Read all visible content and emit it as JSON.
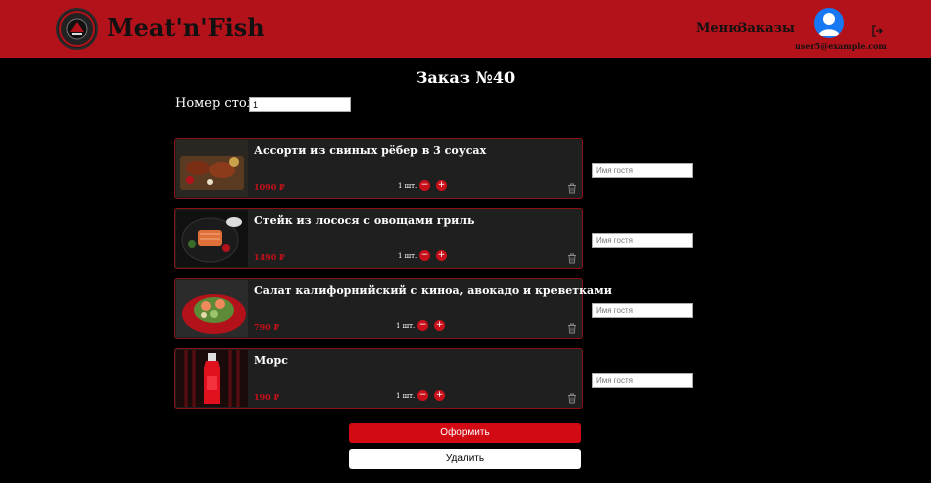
{
  "header": {
    "brand": "Meat'n'Fish",
    "nav": {
      "menu": "Меню",
      "orders": "Заказы"
    },
    "user_email": "user5@example.com"
  },
  "order": {
    "title": "Заказ №40",
    "table_label": "Номер стола:",
    "table_value": "1",
    "items": [
      {
        "name": "Ассорти из свиных рёбер в 3 соусах",
        "price": "1090 ₽",
        "qty": "1 шт.",
        "image": "ribs-platter"
      },
      {
        "name": "Стейк из лосося с овощами гриль",
        "price": "1490 ₽",
        "qty": "1 шт.",
        "image": "salmon-steak"
      },
      {
        "name": "Салат калифорнийский с киноа, авокадо и креветками",
        "price": "790 ₽",
        "qty": "1 шт.",
        "image": "quinoa-salad"
      },
      {
        "name": "Морс",
        "price": "190 ₽",
        "qty": "1 шт.",
        "image": "berry-drink-bottle"
      }
    ],
    "guest_placeholder": "Имя гостя",
    "submit_label": "Оформить",
    "delete_label": "Удалить"
  },
  "colors": {
    "header": "#b3121a",
    "accent": "#c8101a",
    "card": "#1f1f1f",
    "background": "#000000"
  }
}
